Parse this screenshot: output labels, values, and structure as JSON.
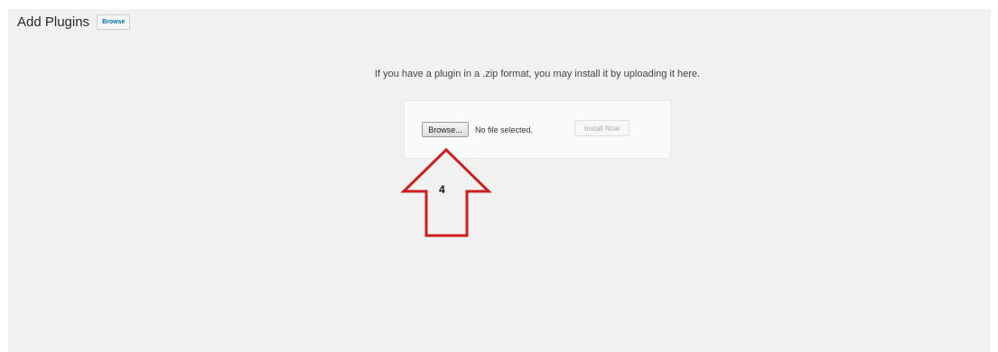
{
  "header": {
    "title": "Add Plugins",
    "action_label": "Browse"
  },
  "upload": {
    "help_text": "If you have a plugin in a .zip format, you may install it by uploading it here.",
    "browse_label": "Browse...",
    "file_status": "No file selected.",
    "install_label": "Install Now"
  },
  "annotation": {
    "step_number": "4",
    "arrow_color": "#cc1f1f",
    "arrow_direction": "up"
  }
}
